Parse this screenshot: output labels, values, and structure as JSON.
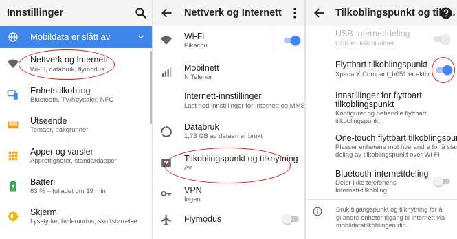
{
  "colors": {
    "accent": "#4285f4",
    "banner": "#3f86ec",
    "highlight": "#e2231a",
    "appbar": "#f4f4f4"
  },
  "panel1": {
    "title": "Innstillinger",
    "search_icon": "search-icon",
    "banner": {
      "label": "Mobildata er slått av",
      "icon": "globe-icon",
      "chevron": "chevron-down-icon"
    },
    "items": [
      {
        "title": "Nettverk og Internett",
        "subtitle": "Wi-Fi, databruk, flymodus",
        "icon": "wifi-icon"
      },
      {
        "title": "Enhetstilkobling",
        "subtitle": "Bluetooth, TV/høyttaler, NFC",
        "icon": "devices-icon"
      },
      {
        "title": "Utseende",
        "subtitle": "Temaer, bakgrunner",
        "icon": "display-icon"
      },
      {
        "title": "Apper og varsler",
        "subtitle": "Apprettigheter, standardapper",
        "icon": "apps-icon"
      },
      {
        "title": "Batteri",
        "subtitle": "83 % – fulladet om 19 min",
        "icon": "battery-icon"
      },
      {
        "title": "Skjerm",
        "subtitle": "Lysstyrke, hvilemodus, skriftstørrelse",
        "icon": "brightness-icon"
      }
    ]
  },
  "panel2": {
    "title": "Nettverk og Internett",
    "back_icon": "back-arrow-icon",
    "menu_icon": "more-vert-icon",
    "items": [
      {
        "title": "Wi-Fi",
        "subtitle": "Pikachu",
        "icon": "wifi-icon",
        "toggle": "on"
      },
      {
        "title": "Mobilnett",
        "subtitle": "N Telenor",
        "icon": "signal-icon"
      },
      {
        "title": "Internett-innstillinger",
        "subtitle": "Last ned innstillinger for Internett og MMS"
      },
      {
        "title": "Databruk",
        "subtitle": "1,73 GB av dataen er brukt",
        "icon": "data-usage-icon"
      },
      {
        "title": "Tilkoblingspunkt og tilknytning",
        "subtitle": "Av",
        "icon": "hotspot-icon"
      },
      {
        "title": "VPN",
        "subtitle": "Ingen",
        "icon": "vpn-key-icon"
      },
      {
        "title": "Flymodus",
        "subtitle": "",
        "icon": "airplane-icon",
        "toggle": "off"
      }
    ]
  },
  "panel3": {
    "title": "Tilkoblingspunkt og tilk...",
    "back_icon": "back-arrow-icon",
    "help_icon": "help-icon",
    "items": [
      {
        "title": "USB-internettdeling",
        "subtitle": "USB er ikke tilkoblet",
        "toggle": "disabled"
      },
      {
        "title": "Flyttbart tilkoblingspunkt",
        "subtitle": "Xperia X Compact_b051 er aktiv",
        "toggle": "on"
      },
      {
        "title_lines": [
          "Innstillinger for flyttbart",
          "tilkoblingspunkt"
        ],
        "subtitle_lines": [
          "Konfigurer og behandle flyttbart",
          "tilkoblingspunkt"
        ]
      },
      {
        "title": "One-touch flyttbart tilkoblingspunkt",
        "subtitle_lines": [
          "Plasser enhetene mot hverandre for å starte",
          "deling av tilkoblingspunkt over Wi-Fi"
        ]
      },
      {
        "title": "Bluetooth-internettdeling",
        "subtitle_lines": [
          "Deler ikke telefonens",
          "Internett-tilkobling"
        ],
        "toggle": "off"
      }
    ],
    "info": {
      "icon": "info-icon",
      "lines": [
        "Bruk tilgangspunkt og tilknytning for å",
        "gi andre enheter tilgang til Internett via",
        "mobildatatilkoblingen din."
      ]
    }
  }
}
